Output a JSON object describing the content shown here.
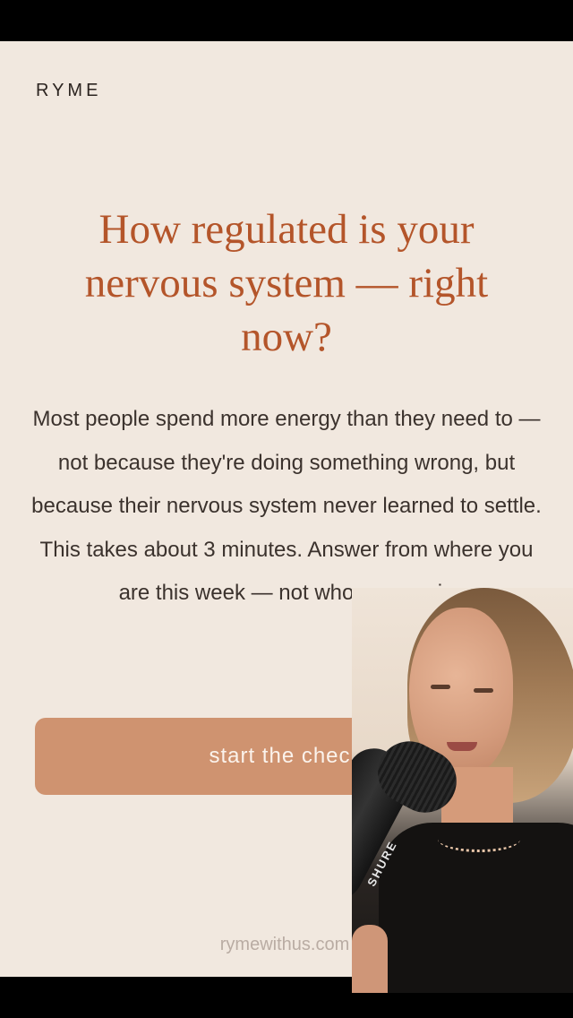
{
  "brand": {
    "name": "RYME"
  },
  "hero": {
    "title": "How regulated is your nervous system — right now?",
    "description": "Most people spend more energy than they need to — not because they're doing something wrong, but because their nervous system never learned to settle. This takes about 3 minutes. Answer from where you are this week — not who you are in"
  },
  "cta": {
    "label": "start the check"
  },
  "footer": {
    "site": "rymewithus.com"
  },
  "overlay": {
    "mic_brand": "SHURE"
  },
  "colors": {
    "background": "#f1e8df",
    "headline": "#b4552a",
    "button": "#cf9370",
    "button_text": "#fbf3ec",
    "footer_text": "#b9aca3"
  }
}
